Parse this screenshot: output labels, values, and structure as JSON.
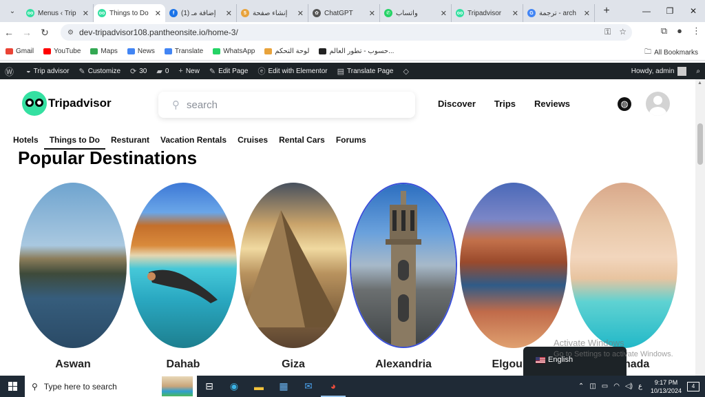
{
  "browser": {
    "tabs": [
      {
        "label": "Menus ‹ Trip",
        "fav_color": "#34e0a1",
        "fav_glyph": "oo",
        "active": false
      },
      {
        "label": "Things to Do",
        "fav_color": "#34e0a1",
        "fav_glyph": "oo",
        "active": true
      },
      {
        "label": "إضافة مـ (1)",
        "fav_color": "#1a73e8",
        "fav_glyph": "f",
        "active": false
      },
      {
        "label": "إنشاء صفحة",
        "fav_color": "#e8a33c",
        "fav_glyph": "5",
        "active": false
      },
      {
        "label": "ChatGPT",
        "fav_color": "#555555",
        "fav_glyph": "✿",
        "active": false
      },
      {
        "label": "واتساب",
        "fav_color": "#25d366",
        "fav_glyph": "✆",
        "active": false
      },
      {
        "label": "Tripadvisor",
        "fav_color": "#34e0a1",
        "fav_glyph": "oo",
        "active": false
      },
      {
        "label": "ترجمة - arch",
        "fav_color": "#4285f4",
        "fav_glyph": "G",
        "active": false
      }
    ],
    "url": "dev-tripadvisor108.pantheonsite.io/home-3/",
    "bookmarks": [
      {
        "label": "Gmail",
        "color": "#ea4335"
      },
      {
        "label": "YouTube",
        "color": "#ff0000"
      },
      {
        "label": "Maps",
        "color": "#34a853"
      },
      {
        "label": "News",
        "color": "#4285f4"
      },
      {
        "label": "Translate",
        "color": "#4285f4"
      },
      {
        "label": "WhatsApp",
        "color": "#25d366"
      },
      {
        "label": "لوحة التحكم",
        "color": "#e8a33c"
      },
      {
        "label": "حسوب - تطور العالم...",
        "color": "#222222"
      }
    ],
    "all_bookmarks": "All Bookmarks"
  },
  "adminbar": {
    "site_name": "Trip advisor",
    "customize": "Customize",
    "updates": "30",
    "comments": "0",
    "new": "New",
    "edit_page": "Edit Page",
    "elementor": "Edit with Elementor",
    "translate": "Translate Page",
    "howdy": "Howdy, admin"
  },
  "site": {
    "logo": "Tripadvisor",
    "search_placeholder": "search",
    "nav": [
      "Discover",
      "Trips",
      "Reviews"
    ],
    "subnav": [
      "Hotels",
      "Things to Do",
      "Resturant",
      "Vacation Rentals",
      "Cruises",
      "Rental Cars",
      "Forums"
    ],
    "section_title": "Popular Destinations",
    "destinations": [
      "Aswan",
      "Dahab",
      "Giza",
      "Alexandria",
      "Elgouna",
      "Hurghada"
    ]
  },
  "watermark": {
    "line1": "Activate Windows",
    "line2": "Go to Settings to activate Windows."
  },
  "language_switcher": "English",
  "taskbar": {
    "search_placeholder": "Type here to search",
    "time": "9:17 PM",
    "date": "10/13/2024",
    "lang": "ع",
    "notifications": "4"
  }
}
